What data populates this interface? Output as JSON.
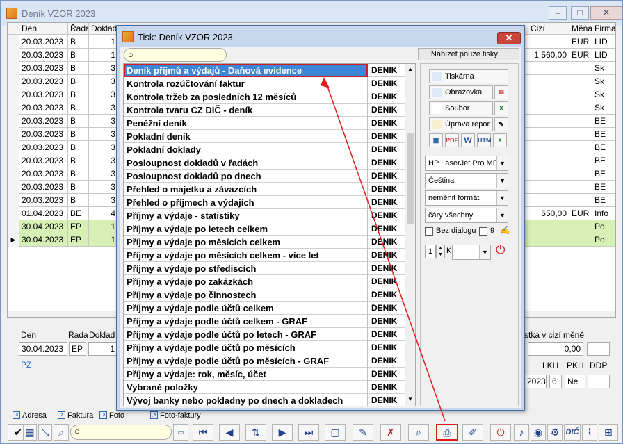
{
  "main_window": {
    "title": "Deník VZOR 2023",
    "buttons": [
      "‒",
      "□",
      "✕"
    ]
  },
  "grid": {
    "headers": [
      "Den",
      "Řada",
      "Doklad",
      "Cizí",
      "Měna",
      "Firma"
    ],
    "rows": [
      {
        "den": "20.03.2023",
        "rada": "B",
        "doklad": "1",
        "cizi": "",
        "mena": "EUR",
        "firma": "LID"
      },
      {
        "den": "20.03.2023",
        "rada": "B",
        "doklad": "1",
        "cizi": "1 560,00",
        "mena": "EUR",
        "firma": "LID"
      },
      {
        "den": "20.03.2023",
        "rada": "B",
        "doklad": "3",
        "cizi": "",
        "mena": "",
        "firma": "Sk"
      },
      {
        "den": "20.03.2023",
        "rada": "B",
        "doklad": "3",
        "cizi": "",
        "mena": "",
        "firma": "Sk"
      },
      {
        "den": "20.03.2023",
        "rada": "B",
        "doklad": "3",
        "cizi": "",
        "mena": "",
        "firma": "Sk"
      },
      {
        "den": "20.03.2023",
        "rada": "B",
        "doklad": "3",
        "cizi": "",
        "mena": "",
        "firma": "Sk"
      },
      {
        "den": "20.03.2023",
        "rada": "B",
        "doklad": "3",
        "cizi": "",
        "mena": "",
        "firma": "BE"
      },
      {
        "den": "20.03.2023",
        "rada": "B",
        "doklad": "3",
        "cizi": "",
        "mena": "",
        "firma": "BE"
      },
      {
        "den": "20.03.2023",
        "rada": "B",
        "doklad": "3",
        "cizi": "",
        "mena": "",
        "firma": "BE"
      },
      {
        "den": "20.03.2023",
        "rada": "B",
        "doklad": "3",
        "cizi": "",
        "mena": "",
        "firma": "BE"
      },
      {
        "den": "20.03.2023",
        "rada": "B",
        "doklad": "3",
        "cizi": "",
        "mena": "",
        "firma": "BE"
      },
      {
        "den": "20.03.2023",
        "rada": "B",
        "doklad": "3",
        "cizi": "",
        "mena": "",
        "firma": "BE"
      },
      {
        "den": "20.03.2023",
        "rada": "B",
        "doklad": "3",
        "cizi": "",
        "mena": "",
        "firma": "BE"
      },
      {
        "den": "01.04.2023",
        "rada": "BE",
        "doklad": "4",
        "cizi": "650,00",
        "mena": "EUR",
        "firma": "Info"
      },
      {
        "den": "30.04.2023",
        "rada": "EP",
        "doklad": "1",
        "cizi": "",
        "mena": "",
        "firma": "Po"
      },
      {
        "den": "30.04.2023",
        "rada": "EP",
        "doklad": "1",
        "cizi": "",
        "mena": "",
        "firma": "Po"
      }
    ]
  },
  "detail": {
    "den_label": "Den",
    "rada_label": "Řada",
    "doklad_label": "Doklad",
    "den_value": "30.04.2023",
    "rada_value": "EP",
    "doklad_value": "1",
    "pz": "PZ",
    "castka_label": "stka v cizí měně",
    "castka_value": "0,00",
    "lkh_label": "LKH",
    "pkh_label": "PKH",
    "ddp_label": "DDP",
    "date_value": "2023",
    "lkh_value": "6",
    "pkh_value": "Ne",
    "ddp_value": ""
  },
  "tabs": [
    "Adresa",
    "Faktura",
    "Foto",
    "Foto-faktury"
  ],
  "dialog": {
    "title": "Tisk: Deník VZOR 2023",
    "pouze_label": "Nabízet pouze tisky ...",
    "reports": [
      {
        "name": "Deník příjmů a výdajů - Daňová evidence",
        "code": "DENIK"
      },
      {
        "name": "Kontrola rozúčtování faktur",
        "code": "DENIK"
      },
      {
        "name": "Kontrola tržeb za posledních 12 měsíců",
        "code": "DENIK"
      },
      {
        "name": "Kontrola tvaru CZ DIČ - deník",
        "code": "DENIK"
      },
      {
        "name": "Peněžní deník",
        "code": "DENIK"
      },
      {
        "name": "Pokladní deník",
        "code": "DENIK"
      },
      {
        "name": "Pokladní doklady",
        "code": "DENIK"
      },
      {
        "name": "Posloupnost dokladů v řadách",
        "code": "DENIK"
      },
      {
        "name": "Posloupnost dokladů po dnech",
        "code": "DENIK"
      },
      {
        "name": "Přehled o majetku a závazcích",
        "code": "DENIK"
      },
      {
        "name": "Přehled o příjmech a výdajích",
        "code": "DENIK"
      },
      {
        "name": "Příjmy a výdaje - statistiky",
        "code": "DENIK"
      },
      {
        "name": "Příjmy a výdaje po letech celkem",
        "code": "DENIK"
      },
      {
        "name": "Příjmy a výdaje po měsících celkem",
        "code": "DENIK"
      },
      {
        "name": "Příjmy a výdaje po měsících celkem - více let",
        "code": "DENIK"
      },
      {
        "name": "Příjmy a výdaje po střediscích",
        "code": "DENIK"
      },
      {
        "name": "Příjmy a výdaje po zakázkách",
        "code": "DENIK"
      },
      {
        "name": "Příjmy a výdaje po činnostech",
        "code": "DENIK"
      },
      {
        "name": "Příjmy a výdaje podle účtů celkem",
        "code": "DENIK"
      },
      {
        "name": "Příjmy a výdaje podle účtů celkem - GRAF",
        "code": "DENIK"
      },
      {
        "name": "Příjmy a výdaje podle účtů po letech - GRAF",
        "code": "DENIK"
      },
      {
        "name": "Příjmy a výdaje podle účtů po měsících",
        "code": "DENIK"
      },
      {
        "name": "Příjmy a výdaje podle účtů po měsících - GRAF",
        "code": "DENIK"
      },
      {
        "name": "Příjmy a výdaje: rok, měsíc, účet",
        "code": "DENIK"
      },
      {
        "name": "Vybrané položky",
        "code": "DENIK"
      },
      {
        "name": "Vývoj banky nebo pokladny po dnech a dokladech",
        "code": "DENIK"
      }
    ],
    "right_panel": {
      "tiskarna": "Tiskárna",
      "obrazovka": "Obrazovka",
      "soubor": "Soubor",
      "uprava": "Úprava repor",
      "printer": "HP LaserJet Pro MFP",
      "language": "Čeština",
      "format": "neměnit formát",
      "lines": "čáry všechny",
      "bez_dialogu": "Bez dialogu",
      "nine": "9",
      "copies": "1",
      "k": "K"
    }
  },
  "toolbar": {
    "dic": "DIČ"
  }
}
